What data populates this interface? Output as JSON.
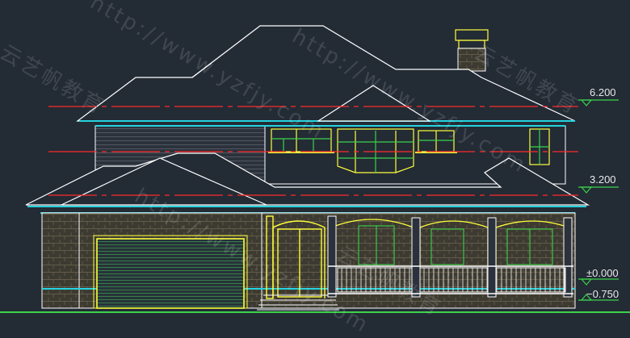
{
  "levels": {
    "roof_eave": "6.200",
    "floor_two": "3.200",
    "ground": "±0.000",
    "grade": "−0.750"
  },
  "watermarks": {
    "url": "http://www.yzfjy.com",
    "brand": "云艺帆教育"
  },
  "colors": {
    "background": "#232b35",
    "outline": "#ffffff",
    "cyan": "#25d3df",
    "yellow": "#ffff3c",
    "green": "#3bd24a",
    "red": "#ff2a2a",
    "stone": "#4a4638"
  }
}
